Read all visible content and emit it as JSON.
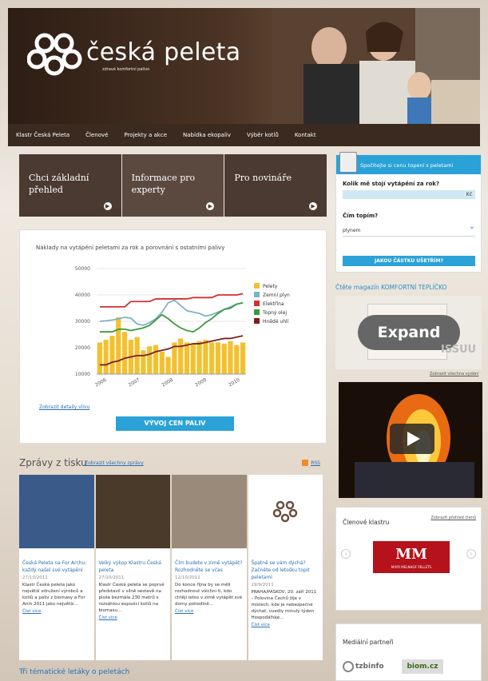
{
  "brand": {
    "name": "česká peleta",
    "tagline": "zdravé komfortní palivo"
  },
  "nav": [
    "Klastr Česká Peleta",
    "Členové",
    "Projekty a akce",
    "Nabídka ekopaliv",
    "Výběr kotlů",
    "Kontakt"
  ],
  "tiles": [
    "Chci základní přehled",
    "Informace pro experty",
    "Pro novináře"
  ],
  "chart": {
    "link": "Zobrazit detaily vlivu",
    "button": "VÝVOJ CEN PALIV"
  },
  "chart_data": {
    "type": "bar",
    "title": "Náklady na vytápění peletami za rok a porovnání s ostatními palivy",
    "ylim": [
      10000,
      50000
    ],
    "yticks": [
      10000,
      20000,
      30000,
      40000,
      50000
    ],
    "xticks": [
      "2006",
      "2007",
      "2008",
      "2009",
      "2010"
    ],
    "grid": true,
    "legend": "right",
    "series": [
      {
        "name": "Pelety",
        "type": "bar",
        "color": "#f2c12e",
        "values": [
          22000,
          23000,
          24500,
          31500,
          26000,
          23000,
          24000,
          19000,
          20500,
          21000,
          18500,
          16500,
          22000,
          23500,
          22000,
          21500,
          22500,
          23000,
          22000,
          22000,
          21500,
          22500,
          21000,
          22000
        ]
      },
      {
        "name": "Zemní plyn",
        "type": "line",
        "color": "#7fb2c8",
        "values": [
          30000,
          30200,
          30500,
          31000,
          31500,
          31200,
          29000,
          28500,
          29500,
          31000,
          33500,
          37000,
          38000,
          36000,
          34000,
          33500,
          33000,
          32000,
          32500,
          33500,
          34500,
          35500,
          36500,
          37000
        ]
      },
      {
        "name": "Elektřina",
        "type": "line",
        "color": "#d62f2f",
        "values": [
          35500,
          35500,
          35500,
          35500,
          35500,
          37500,
          37500,
          37500,
          37500,
          38500,
          38500,
          38500,
          38500,
          38500,
          38500,
          39000,
          39000,
          39000,
          39000,
          40000,
          40000,
          40000,
          40000,
          40500
        ]
      },
      {
        "name": "Topný olej",
        "type": "line",
        "color": "#3a9a3a",
        "values": [
          26000,
          26000,
          26000,
          27000,
          27000,
          26500,
          27000,
          27500,
          28500,
          30500,
          32500,
          31000,
          29000,
          27500,
          26500,
          26000,
          27500,
          29500,
          31000,
          33000,
          34500,
          35000,
          36500,
          37000
        ]
      },
      {
        "name": "Hnědé uhlí",
        "type": "line",
        "color": "#7a1f1f",
        "values": [
          13500,
          13500,
          14500,
          15000,
          16000,
          16500,
          17000,
          17000,
          17500,
          18500,
          19000,
          19500,
          20500,
          20500,
          21000,
          21500,
          21500,
          22000,
          22500,
          23000,
          23500,
          23500,
          24000,
          24500
        ]
      }
    ]
  },
  "news": {
    "title": "Zprávy z tisku",
    "all_link": "Zobrazit všechny zprávy",
    "rss": "RSS",
    "items": [
      {
        "title": "Česká Peleta na For Archu: každý našel své vytápění",
        "date": "27/10/2011",
        "text": "Klastr Česká peleta jako největší sdružení výrobců a kotlů a paliv z biomasy a For Arch 2011 jako největší...",
        "more": "Číst více",
        "img": "#3a5a8a"
      },
      {
        "title": "Velký výkop Klastru Česká peleta",
        "date": "27/10/2011",
        "text": "Klastr Česká peleta se poprvé představil v silně sestavě na ploše bezmála 230 metrů s rozsáhlou expozicí kotlů na biomasu...",
        "more": "Číst více",
        "img": "#4a3a2a"
      },
      {
        "title": "Čím budete v zimě vytápět? Rozhodněte se včas",
        "date": "12/10/2011",
        "text": "Do konce října by se měli rozhodnout všichni ti, kdo chtějí letos v zimě vytápět své domy pohodlně...",
        "more": "Číst více",
        "img": "#9a8a7a"
      },
      {
        "title": "Špatně se vám dýchá? Začněte od letošku topit peletami",
        "date": "19/9/2011",
        "text": "PRAHA/PASKOV, 20. září 2011 – Polovina Čechů žije v místech, kde je nebezpečné dýchat, uvedly minulý týden Hospodářské...",
        "more": "Číst více",
        "img": "#ffffff"
      }
    ]
  },
  "themes": "Tři tématické letáky o peletách",
  "calc": {
    "header": "Spočítejte si cenu topení s peletami",
    "q1": "Kolik mě stojí vytápění za rok?",
    "currency": "Kč",
    "q2": "Čím topím?",
    "selected": "plynem",
    "button": "JAKOU ČÁSTKU UŠETŘÍM?"
  },
  "magazine": {
    "title": "Čtěte magazín KOMFORTNÍ TEPLÍČKO",
    "expand": "Expand",
    "logo_text": "ISSUU",
    "link": "Zobrazit všechna vydání"
  },
  "members": {
    "title": "Členové klastru",
    "link": "Zobrazit přehled členů",
    "logo": "MM",
    "logo_name": "MAYR MELNHOF PELLETS"
  },
  "partners": {
    "title": "Mediální partneři",
    "p1": "tzbinfo",
    "p2": "biom.cz"
  }
}
